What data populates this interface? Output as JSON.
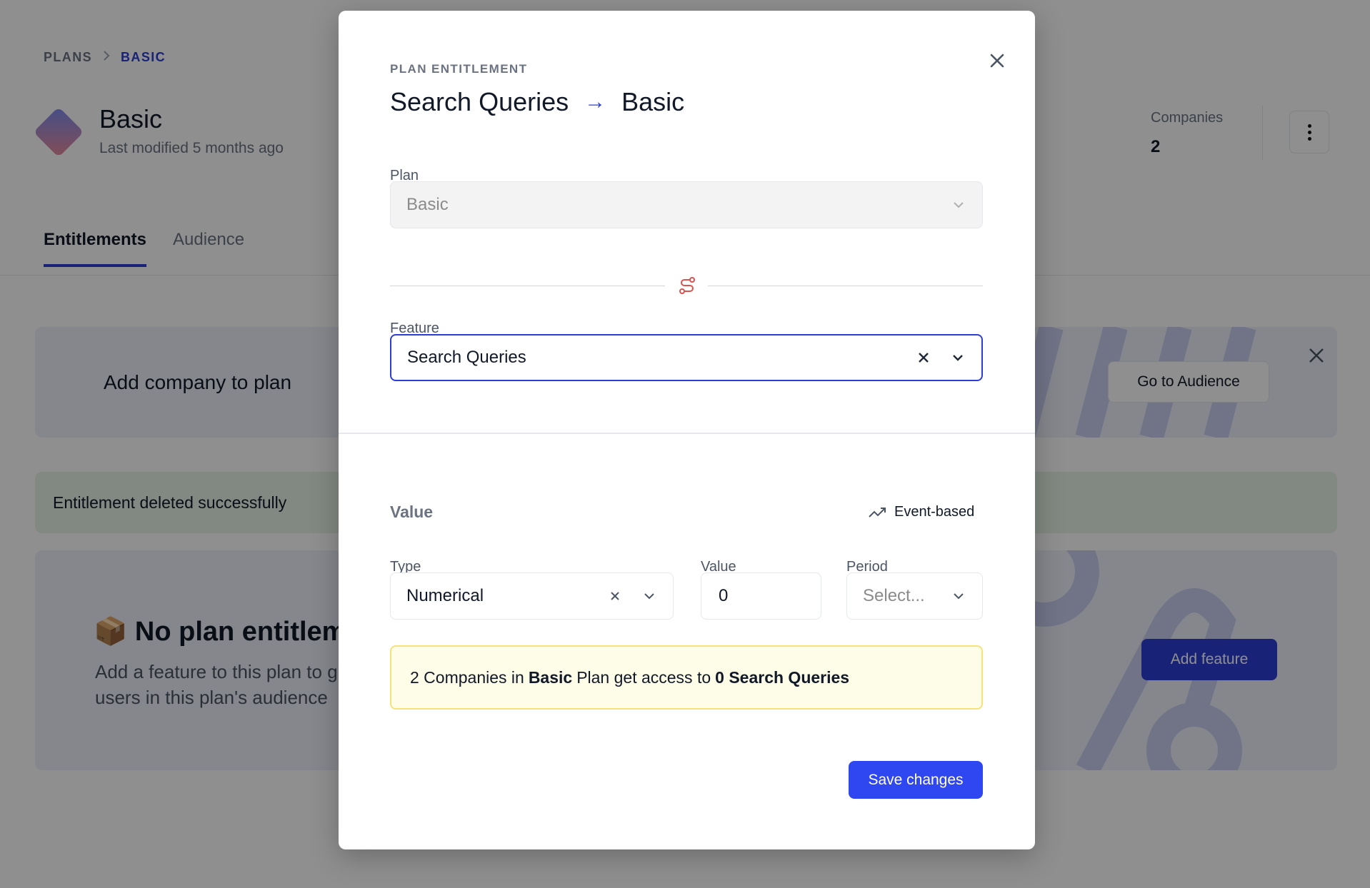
{
  "breadcrumb": {
    "plans": "PLANS",
    "current": "BASIC"
  },
  "plan": {
    "name": "Basic",
    "modified": "Last modified 5 months ago"
  },
  "stats": {
    "companies_label": "Companies",
    "companies_count": "2"
  },
  "tabs": [
    {
      "label": "Entitlements"
    },
    {
      "label": "Audience"
    }
  ],
  "add_company_card": {
    "title": "Add company to plan",
    "button": "Go to Audience"
  },
  "success_alert": {
    "text": "Entitlement deleted successfully"
  },
  "empty_state": {
    "emoji": "📦",
    "title": "No plan entitlem",
    "line1": "Add a feature to this plan to g",
    "line2": "users in this plan's audience",
    "button": "Add feature"
  },
  "modal": {
    "eyebrow": "PLAN ENTITLEMENT",
    "title_feature": "Search Queries",
    "title_arrow": "→",
    "title_plan": "Basic",
    "plan_label": "Plan",
    "plan_value": "Basic",
    "feature_label": "Feature",
    "feature_value": "Search Queries",
    "value_heading": "Value",
    "event_based": "Event-based",
    "type_label": "Type",
    "type_value": "Numerical",
    "value_label": "Value",
    "value_value": "0",
    "period_label": "Period",
    "period_placeholder": "Select...",
    "notice": {
      "prefix": "2 Companies in",
      "plan": "Basic",
      "middle": "Plan get access to",
      "amount": "0 Search Queries"
    },
    "save": "Save changes"
  },
  "colors": {
    "accent": "#2b3fd6",
    "save": "#2f47f0",
    "notice_bg": "#fefde8",
    "notice_border": "#f7e27a",
    "success_bg": "#e6f4e8",
    "card_bg": "#eef0fb"
  }
}
